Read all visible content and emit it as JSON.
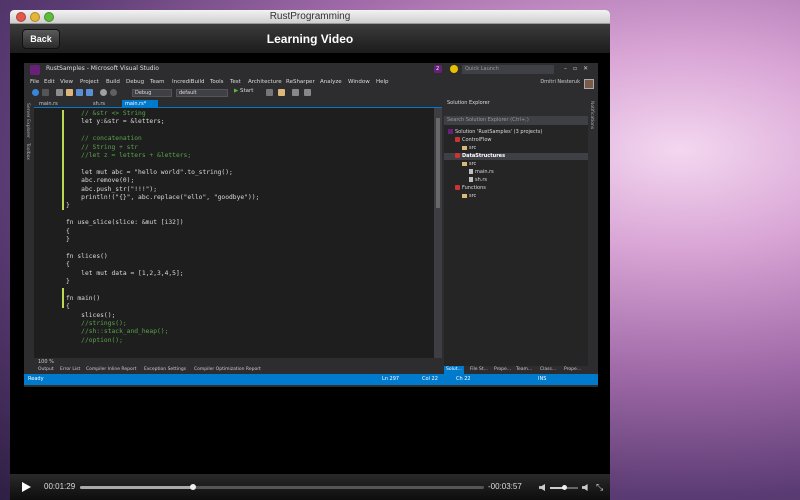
{
  "window": {
    "title": "RustProgramming"
  },
  "nav": {
    "back_label": "Back",
    "title": "Learning Video"
  },
  "vs": {
    "title": "RustSamples - Microsoft Visual Studio",
    "notification_count": "2",
    "quick_launch_placeholder": "Quick Launch",
    "menu": [
      "File",
      "Edit",
      "View",
      "Project",
      "Build",
      "Debug",
      "Team",
      "IncrediBuild",
      "Tools",
      "Test",
      "Architecture",
      "ReSharper",
      "Analyze",
      "Window",
      "Help"
    ],
    "user": "Dmitri Nesteruk",
    "toolbar": {
      "config": "Debug",
      "platform": "default",
      "start": "Start"
    },
    "left_strip": [
      "Server Explorer",
      "Toolbox"
    ],
    "right_strip": "Notifications",
    "tabs": [
      "main.rs",
      "sh.rs",
      "main.rs*"
    ],
    "code_lines": [
      {
        "text": "    // &str <> String",
        "cls": "ln-com"
      },
      {
        "text": "    let y:&str = &letters;",
        "cls": ""
      },
      {
        "text": "",
        "cls": ""
      },
      {
        "text": "    // concatenation",
        "cls": "ln-com"
      },
      {
        "text": "    // String + str",
        "cls": "ln-com"
      },
      {
        "text": "    //let z = letters + &letters;",
        "cls": "ln-com"
      },
      {
        "text": "",
        "cls": ""
      },
      {
        "text": "    let mut abc = \"hello world\".to_string();",
        "cls": ""
      },
      {
        "text": "    abc.remove(0);",
        "cls": ""
      },
      {
        "text": "    abc.push_str(\"!!!\");",
        "cls": ""
      },
      {
        "text": "    println!(\"{}\", abc.replace(\"ello\", \"goodbye\"));",
        "cls": ""
      },
      {
        "text": "}",
        "cls": ""
      },
      {
        "text": "",
        "cls": ""
      },
      {
        "text": "fn use_slice(slice: &mut [i32])",
        "cls": ""
      },
      {
        "text": "{",
        "cls": ""
      },
      {
        "text": "}",
        "cls": ""
      },
      {
        "text": "",
        "cls": ""
      },
      {
        "text": "fn slices()",
        "cls": ""
      },
      {
        "text": "{",
        "cls": ""
      },
      {
        "text": "    let mut data = [1,2,3,4,5];",
        "cls": ""
      },
      {
        "text": "}",
        "cls": ""
      },
      {
        "text": "",
        "cls": ""
      },
      {
        "text": "fn main()",
        "cls": ""
      },
      {
        "text": "{",
        "cls": ""
      },
      {
        "text": "    slices();",
        "cls": ""
      },
      {
        "text": "    //strings();",
        "cls": "ln-com"
      },
      {
        "text": "    //sh::stack_and_heap();",
        "cls": "ln-com"
      },
      {
        "text": "    //option();",
        "cls": "ln-com"
      }
    ],
    "zoom": "100 %",
    "solution": {
      "header": "Solution Explorer",
      "search": "Search Solution Explorer (Ctrl+;)",
      "items": [
        {
          "label": "Solution 'RustSamples' (3 projects)",
          "type": "sol",
          "indent": 0,
          "sel": false
        },
        {
          "label": "ControlFlow",
          "type": "proj",
          "indent": 1,
          "sel": false
        },
        {
          "label": "src",
          "type": "folder",
          "indent": 2,
          "sel": false
        },
        {
          "label": "DataStructures",
          "type": "proj",
          "indent": 1,
          "sel": true
        },
        {
          "label": "src",
          "type": "folder",
          "indent": 2,
          "sel": false
        },
        {
          "label": "main.rs",
          "type": "file",
          "indent": 3,
          "sel": false
        },
        {
          "label": "sh.rs",
          "type": "file",
          "indent": 3,
          "sel": false
        },
        {
          "label": "Functions",
          "type": "proj",
          "indent": 1,
          "sel": false
        },
        {
          "label": "src",
          "type": "folder",
          "indent": 2,
          "sel": false
        }
      ],
      "tabs": [
        "Solut...",
        "File St...",
        "Prope...",
        "Team...",
        "Class...",
        "Prope..."
      ]
    },
    "bottom_tabs": [
      "Output",
      "Error List",
      "Compiler Inline Report",
      "Exception Settings",
      "Compiler Optimization Report"
    ],
    "status": {
      "ready": "Ready",
      "ln": "Ln 297",
      "col": "Col 22",
      "ch": "Ch 22",
      "ins": "INS"
    }
  },
  "player": {
    "elapsed": "00:01:29",
    "remaining": "-00:03:57",
    "progress": 0.28,
    "volume": 0.5
  }
}
